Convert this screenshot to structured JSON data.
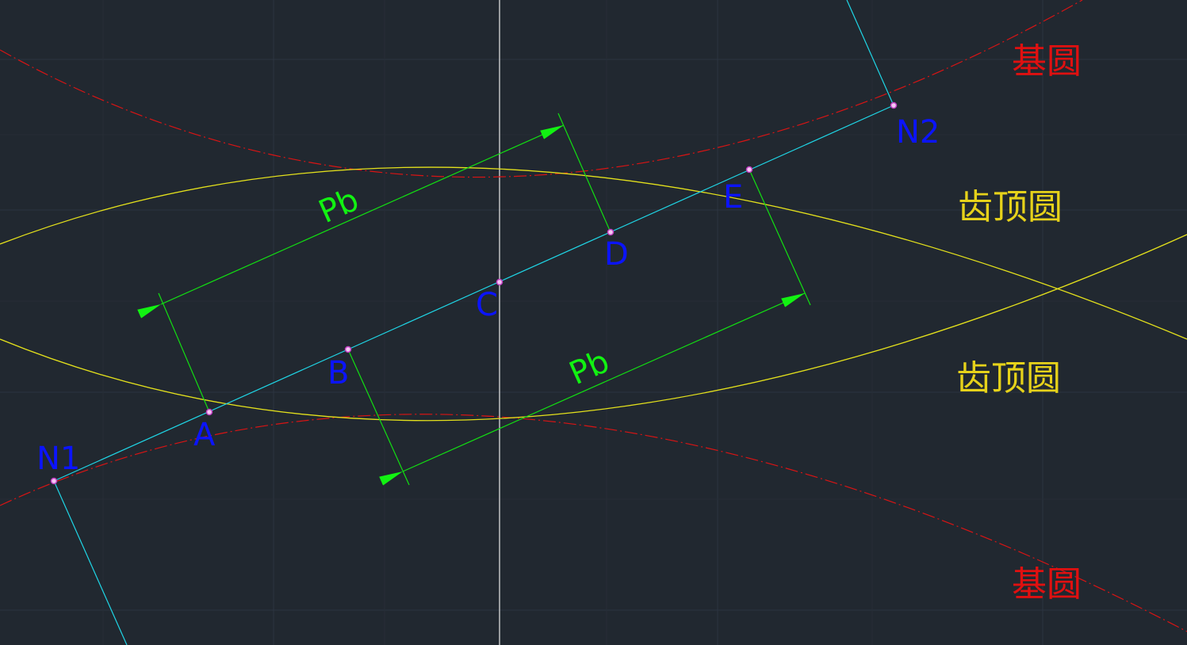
{
  "colors": {
    "background": "#212830",
    "grid": "#2c3440",
    "base_circle": "#d91414",
    "addendum_circle": "#e4e11c",
    "line_of_action": "#1fd6e6",
    "dimension": "#12e012",
    "point_label": "#0b14ff",
    "point_marker": "#d24fd2",
    "center_line": "#e8e8e8"
  },
  "points": [
    {
      "id": "N1",
      "label": "N1"
    },
    {
      "id": "A",
      "label": "A"
    },
    {
      "id": "B",
      "label": "B"
    },
    {
      "id": "C",
      "label": "C"
    },
    {
      "id": "D",
      "label": "D"
    },
    {
      "id": "E",
      "label": "E"
    },
    {
      "id": "N2",
      "label": "N2"
    }
  ],
  "dimensions": [
    {
      "id": "upper",
      "label": "Pb"
    },
    {
      "id": "lower",
      "label": "Pb"
    }
  ],
  "circle_labels": [
    {
      "id": "base-top",
      "text": "基圆",
      "color": "#e01010"
    },
    {
      "id": "addendum-upper",
      "text": "齿顶圆",
      "color": "#e6d21a"
    },
    {
      "id": "addendum-lower",
      "text": "齿顶圆",
      "color": "#e6d21a"
    },
    {
      "id": "base-bottom",
      "text": "基圆",
      "color": "#e01010"
    }
  ]
}
